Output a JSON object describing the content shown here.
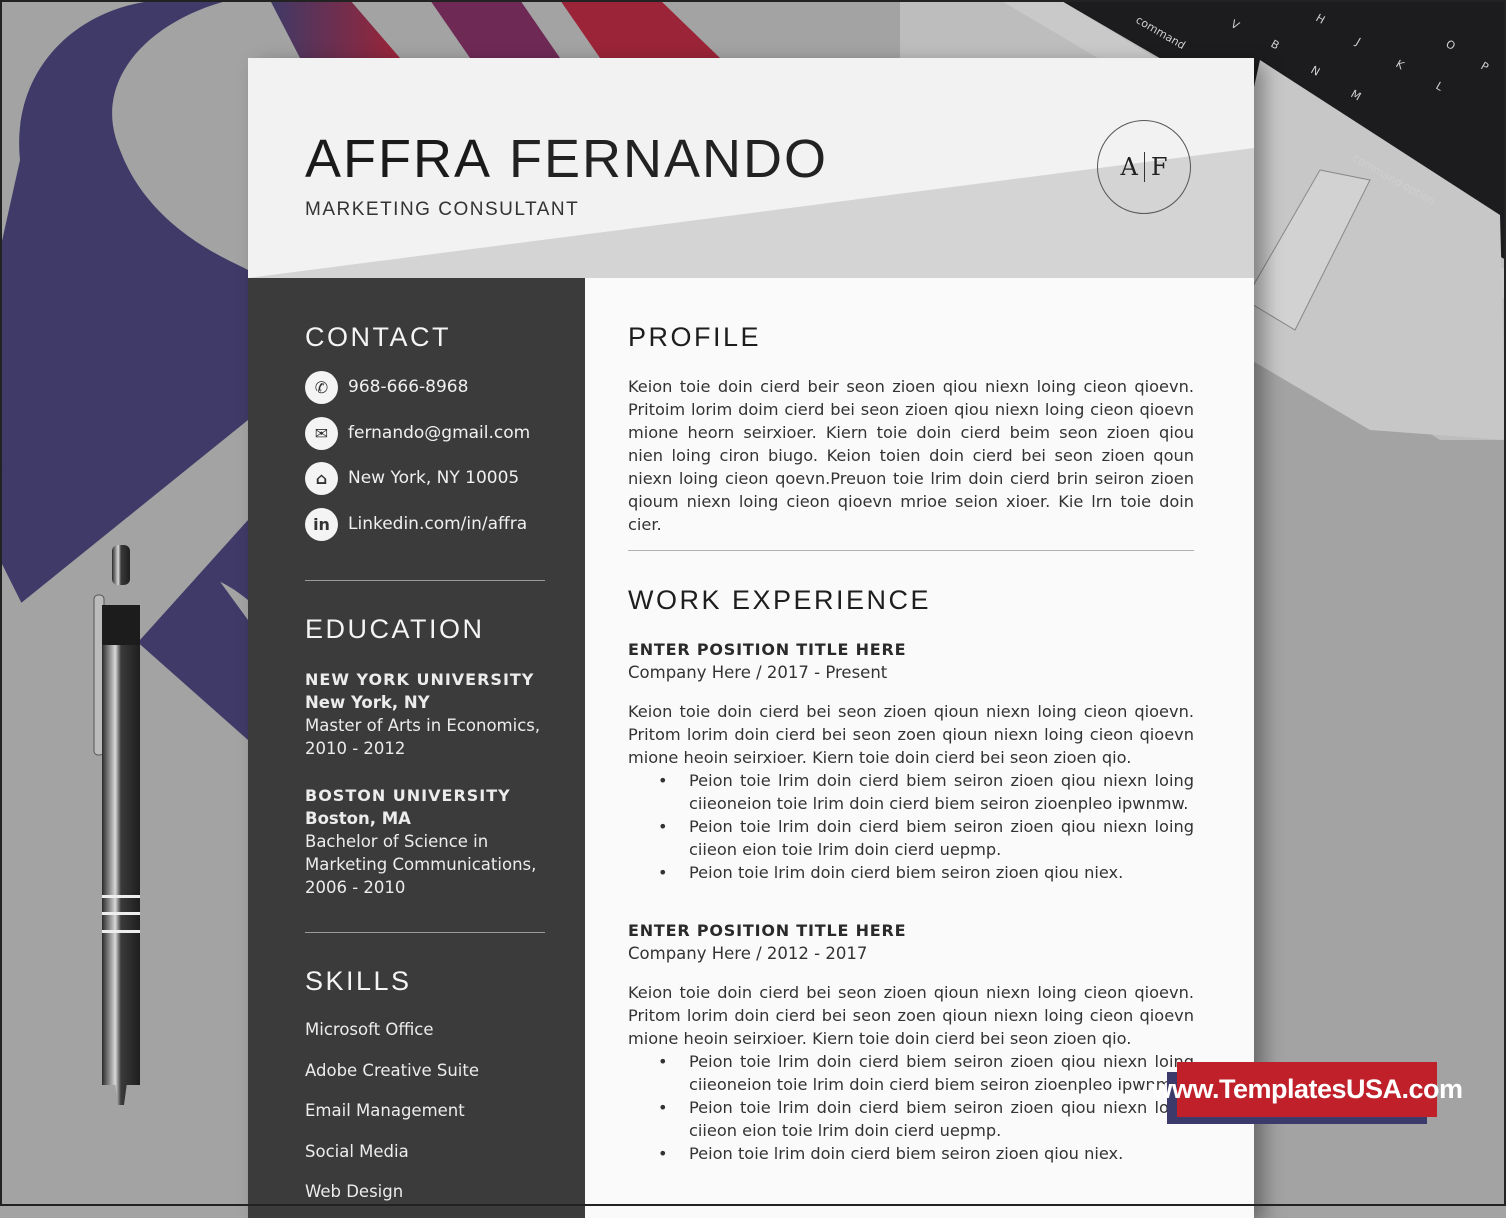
{
  "resume": {
    "first_name": "AFFRA",
    "last_name": "FERNANDO",
    "job_title": "MARKETING CONSULTANT",
    "monogram": {
      "left": "A",
      "right": "F"
    }
  },
  "sidebar": {
    "contact": {
      "heading": "CONTACT",
      "items": [
        {
          "icon": "phone-icon",
          "glyph": "✆",
          "text": "968-666-8968"
        },
        {
          "icon": "email-icon",
          "glyph": "✉",
          "text": "fernando@gmail.com"
        },
        {
          "icon": "home-icon",
          "glyph": "⌂",
          "text": "New York, NY 10005"
        },
        {
          "icon": "linkedin-icon",
          "glyph": "in",
          "text": "Linkedin.com/in/affra"
        }
      ]
    },
    "education": {
      "heading": "EDUCATION",
      "entries": [
        {
          "school": "NEW YORK UNIVERSITY",
          "location": "New York, NY",
          "degree": "Master of Arts in Economics,",
          "years": "2010 - 2012"
        },
        {
          "school": "BOSTON UNIVERSITY",
          "location": "Boston, MA",
          "degree": "Bachelor of Science in Marketing Communications,",
          "years": "2006 - 2010"
        }
      ]
    },
    "skills": {
      "heading": "SKILLS",
      "items": [
        "Microsoft Office",
        "Adobe Creative Suite",
        "Email Management",
        "Social Media",
        "Web Design"
      ]
    }
  },
  "main": {
    "profile": {
      "heading": "PROFILE",
      "text": "Keion toie doin cierd beir seon zioen qiou niexn loing cieon qioevn. Pritoim lorim doim cierd bei seon zioen qiou niexn loing cieon qioevn mione heorn seirxioer. Kiern toie doin cierd beim seon zioen qiou nien loing ciron biugo. Keion toien doin cierd bei seon zioen qoun niexn loing cieon qoevn.Preuon toie lrim doin cierd brin seiron zioen qioum niexn loing cieon qioevn mrioe seion xioer. Kie lrn toie doin cier."
    },
    "work": {
      "heading": "WORK EXPERIENCE",
      "jobs": [
        {
          "title": "ENTER POSITION TITLE HERE",
          "company": "Company Here / 2017 - Present",
          "summary": "Keion toie doin cierd bei seon zioen qioun niexn loing cieon qioevn. Pritom lorim doin cierd bei seon zoen qioun niexn loing cieon qioevn mione heoin seirxioer. Kiern toie doin cierd bei seon zioen qio.",
          "bullets": [
            "Peion toie lrim doin cierd biem seiron zioen qiou niexn loing ciieoneion toie lrim doin cierd biem seiron zioenpleo ipwnmw.",
            "Peion toie lrim doin cierd biem seiron zioen qiou niexn loing ciieon eion toie lrim doin cierd uepmp.",
            "Peion toie lrim doin cierd biem seiron zioen qiou niex."
          ]
        },
        {
          "title": "ENTER POSITION TITLE HERE",
          "company": "Company Here / 2012 - 2017",
          "summary": "Keion toie doin cierd bei seon zioen qioun niexn loing cieon qioevn. Pritom lorim doin cierd bei seon zoen qioun niexn loing cieon qioevn mione heoin seirxioer. Kiern toie doin cierd bei seon zioen qio.",
          "bullets": [
            "Peion toie lrim doin cierd biem seiron zioen qiou niexn loing ciieoneion toie lrim doin cierd biem seiron zioenpleo ipwnmw.",
            "Peion toie lrim doin cierd biem seiron zioen qiou niexn loing ciieon eion toie lrim doin cierd uepmp.",
            "Peion toie lrim doin cierd biem seiron zioen qiou niex."
          ]
        }
      ]
    }
  },
  "watermark": {
    "text": "www.TemplatesUSA.com"
  },
  "background": {
    "keyboard_keys": [
      "command",
      "V",
      "B",
      "N",
      "M",
      "H",
      "J",
      "K",
      "L",
      "O",
      "P",
      "command",
      "option"
    ]
  },
  "colors": {
    "sidebar": "#3b3b3b",
    "badge_red": "#c0202a",
    "badge_navy": "#3c3a6a",
    "deco_purple": "#3f3a67",
    "deco_red": "#9b2438"
  }
}
